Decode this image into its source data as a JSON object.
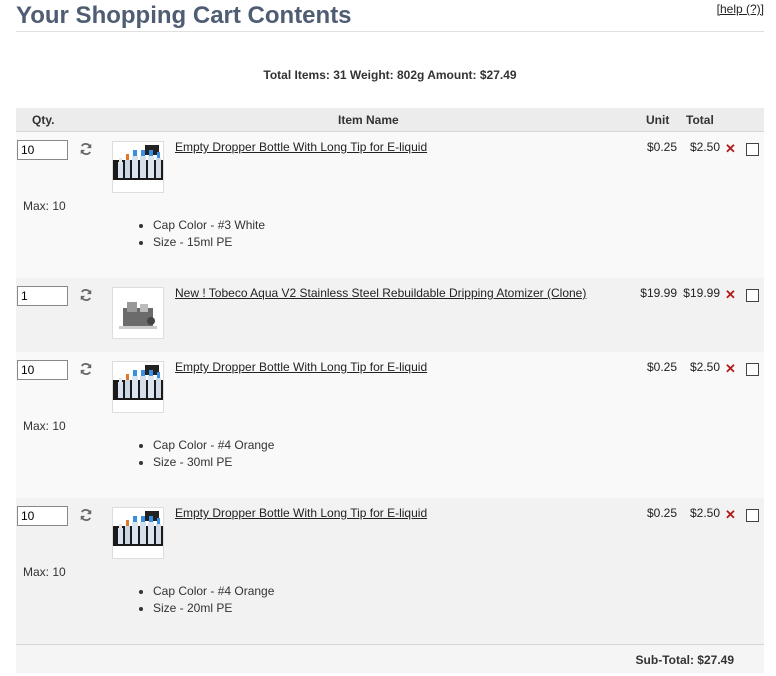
{
  "page": {
    "title": "Your Shopping Cart Contents",
    "help": "[help (?)]"
  },
  "totals": {
    "text": "Total Items: 31  Weight: 802g  Amount: $27.49"
  },
  "columns": {
    "qty": "Qty.",
    "item": "Item Name",
    "unit": "Unit",
    "total": "Total"
  },
  "rows": [
    {
      "qty": "10",
      "name": "Empty Dropper Bottle With Long Tip for E-liquid",
      "unit": "$0.25",
      "total": "$2.50",
      "max": "Max: 10",
      "attrs": [
        "Cap Color - #3 White",
        "Size - 15ml PE"
      ]
    },
    {
      "qty": "1",
      "name": "New ! Tobeco Aqua V2 Stainless Steel Rebuildable Dripping Atomizer (Clone)",
      "unit": "$19.99",
      "total": "$19.99"
    },
    {
      "qty": "10",
      "name": "Empty Dropper Bottle With Long Tip for E-liquid",
      "unit": "$0.25",
      "total": "$2.50",
      "max": "Max: 10",
      "attrs": [
        "Cap Color - #4 Orange",
        "Size - 30ml PE"
      ]
    },
    {
      "qty": "10",
      "name": "Empty Dropper Bottle With Long Tip for E-liquid",
      "unit": "$0.25",
      "total": "$2.50",
      "max": "Max: 10",
      "attrs": [
        "Cap Color - #4 Orange",
        "Size - 20ml PE"
      ]
    }
  ],
  "subtotal": "Sub-Total: $27.49",
  "icons": {
    "refresh": "refresh-icon",
    "remove": "remove-icon",
    "remove_glyph": "✕",
    "remove_color": "#b21a1a"
  }
}
